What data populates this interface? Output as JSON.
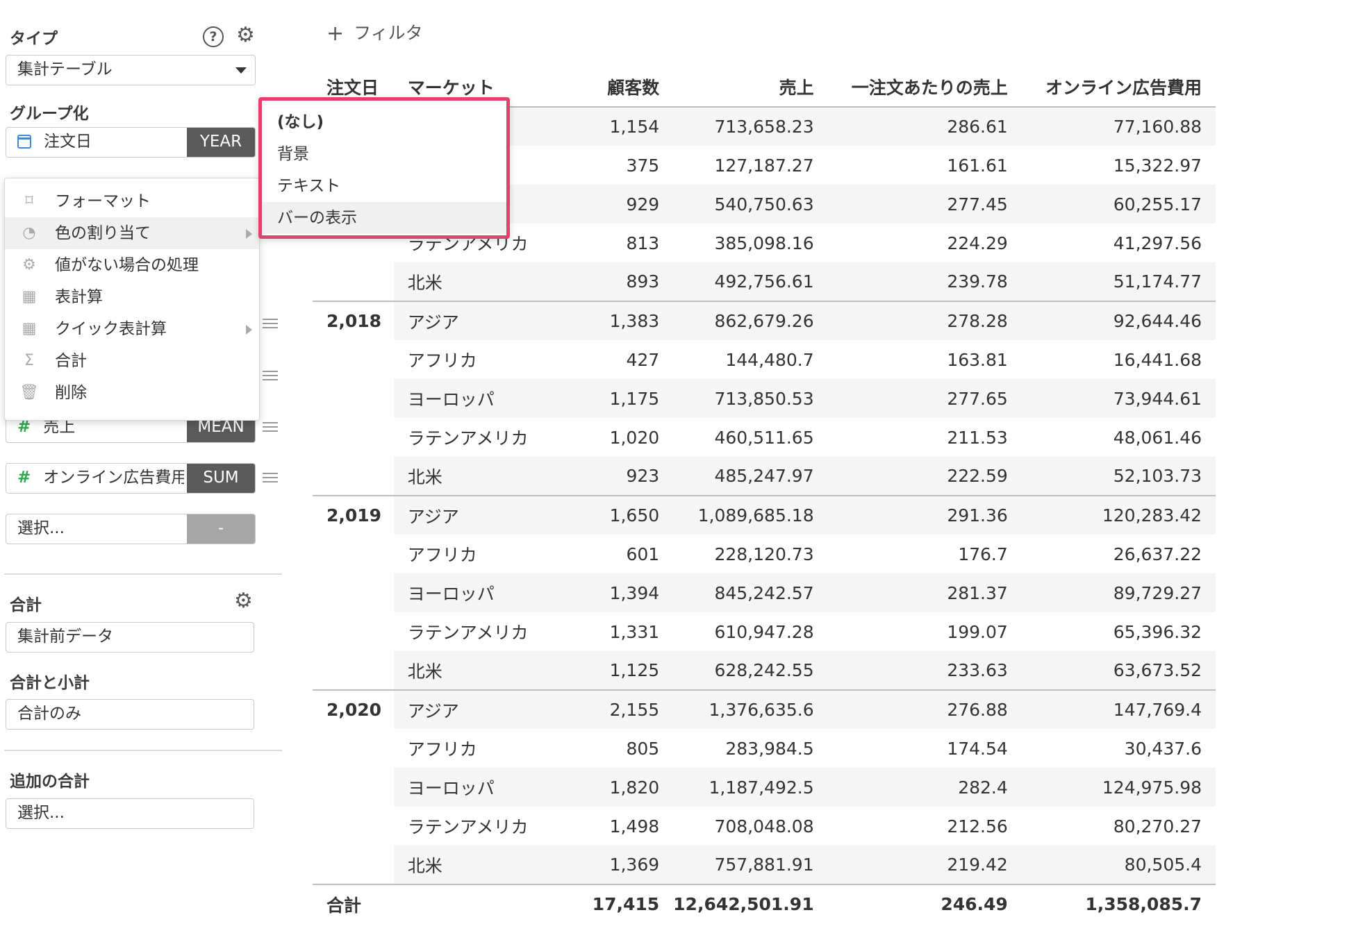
{
  "sidebar": {
    "type_section": {
      "title": "タイプ",
      "help_glyph": "?",
      "gear_glyph": "⚙",
      "selected": "集計テーブル"
    },
    "group_section": {
      "title": "グループ化",
      "field_label": "注文日",
      "field_agg": "YEAR"
    },
    "value_fields": [
      {
        "label": "売上",
        "agg": "MEAN",
        "kind": "number"
      },
      {
        "label": "オンライン広告費用",
        "agg": "SUM",
        "kind": "number"
      }
    ],
    "empty_field": {
      "placeholder": "選択...",
      "agg": "-"
    },
    "total_section": {
      "title": "合計",
      "gear_glyph": "⚙",
      "selected": "集計前データ"
    },
    "subtotal_section": {
      "title": "合計と小計",
      "selected": "合計のみ"
    },
    "extra_total_section": {
      "title": "追加の合計",
      "placeholder": "選択..."
    },
    "hash_glyph": "#"
  },
  "context_menu": {
    "items": [
      {
        "icon": "brush-icon",
        "glyph": "⌑",
        "label": "フォーマット",
        "has_submenu": false,
        "highlighted": false
      },
      {
        "icon": "palette-icon",
        "glyph": "◔",
        "label": "色の割り当て",
        "has_submenu": true,
        "highlighted": true
      },
      {
        "icon": "gear-icon",
        "glyph": "⚙",
        "label": "値がない場合の処理",
        "has_submenu": false,
        "highlighted": false
      },
      {
        "icon": "table-icon",
        "glyph": "▦",
        "label": "表計算",
        "has_submenu": false,
        "highlighted": false
      },
      {
        "icon": "table-icon",
        "glyph": "▦",
        "label": "クイック表計算",
        "has_submenu": true,
        "highlighted": false
      },
      {
        "icon": "sigma-icon",
        "glyph": "Σ",
        "label": "合計",
        "has_submenu": false,
        "highlighted": false
      },
      {
        "icon": "trash-icon",
        "glyph": "🗑",
        "label": "削除",
        "has_submenu": false,
        "highlighted": false
      }
    ]
  },
  "submenu": {
    "border_color": "#e3416b",
    "items": [
      {
        "label": "(なし)",
        "bold": true,
        "highlighted": false
      },
      {
        "label": "背景",
        "bold": false,
        "highlighted": false
      },
      {
        "label": "テキスト",
        "bold": false,
        "highlighted": false
      },
      {
        "label": "バーの表示",
        "bold": false,
        "highlighted": true
      }
    ]
  },
  "main": {
    "filter_label": "フィルタ",
    "filter_glyph": "+",
    "columns": [
      "注文日",
      "マーケット",
      "顧客数",
      "売上",
      "一注文あたりの売上",
      "オンライン広告費用"
    ],
    "groups": [
      {
        "year": "",
        "rows": [
          {
            "market": "",
            "customers": "1,154",
            "sales": "713,658.23",
            "per_order": "286.61",
            "ad_cost": "77,160.88"
          },
          {
            "market": "",
            "customers": "375",
            "sales": "127,187.27",
            "per_order": "161.61",
            "ad_cost": "15,322.97"
          },
          {
            "market": "",
            "customers": "929",
            "sales": "540,750.63",
            "per_order": "277.45",
            "ad_cost": "60,255.17"
          },
          {
            "market": "ラテンアメリカ",
            "customers": "813",
            "sales": "385,098.16",
            "per_order": "224.29",
            "ad_cost": "41,297.56"
          },
          {
            "market": "北米",
            "customers": "893",
            "sales": "492,756.61",
            "per_order": "239.78",
            "ad_cost": "51,174.77"
          }
        ]
      },
      {
        "year": "2,018",
        "rows": [
          {
            "market": "アジア",
            "customers": "1,383",
            "sales": "862,679.26",
            "per_order": "278.28",
            "ad_cost": "92,644.46"
          },
          {
            "market": "アフリカ",
            "customers": "427",
            "sales": "144,480.7",
            "per_order": "163.81",
            "ad_cost": "16,441.68"
          },
          {
            "market": "ヨーロッパ",
            "customers": "1,175",
            "sales": "713,850.53",
            "per_order": "277.65",
            "ad_cost": "73,944.61"
          },
          {
            "market": "ラテンアメリカ",
            "customers": "1,020",
            "sales": "460,511.65",
            "per_order": "211.53",
            "ad_cost": "48,061.46"
          },
          {
            "market": "北米",
            "customers": "923",
            "sales": "485,247.97",
            "per_order": "222.59",
            "ad_cost": "52,103.73"
          }
        ]
      },
      {
        "year": "2,019",
        "rows": [
          {
            "market": "アジア",
            "customers": "1,650",
            "sales": "1,089,685.18",
            "per_order": "291.36",
            "ad_cost": "120,283.42"
          },
          {
            "market": "アフリカ",
            "customers": "601",
            "sales": "228,120.73",
            "per_order": "176.7",
            "ad_cost": "26,637.22"
          },
          {
            "market": "ヨーロッパ",
            "customers": "1,394",
            "sales": "845,242.57",
            "per_order": "281.37",
            "ad_cost": "89,729.27"
          },
          {
            "market": "ラテンアメリカ",
            "customers": "1,331",
            "sales": "610,947.28",
            "per_order": "199.07",
            "ad_cost": "65,396.32"
          },
          {
            "market": "北米",
            "customers": "1,125",
            "sales": "628,242.55",
            "per_order": "233.63",
            "ad_cost": "63,673.52"
          }
        ]
      },
      {
        "year": "2,020",
        "rows": [
          {
            "market": "アジア",
            "customers": "2,155",
            "sales": "1,376,635.6",
            "per_order": "276.88",
            "ad_cost": "147,769.4"
          },
          {
            "market": "アフリカ",
            "customers": "805",
            "sales": "283,984.5",
            "per_order": "174.54",
            "ad_cost": "30,437.6"
          },
          {
            "market": "ヨーロッパ",
            "customers": "1,820",
            "sales": "1,187,492.5",
            "per_order": "282.4",
            "ad_cost": "124,975.98"
          },
          {
            "market": "ラテンアメリカ",
            "customers": "1,498",
            "sales": "708,048.08",
            "per_order": "212.56",
            "ad_cost": "80,270.27"
          },
          {
            "market": "北米",
            "customers": "1,369",
            "sales": "757,881.91",
            "per_order": "219.42",
            "ad_cost": "80,505.4"
          }
        ]
      }
    ],
    "total_row": {
      "label": "合計",
      "customers": "17,415",
      "sales": "12,642,501.91",
      "per_order": "246.49",
      "ad_cost": "1,358,085.7"
    }
  }
}
